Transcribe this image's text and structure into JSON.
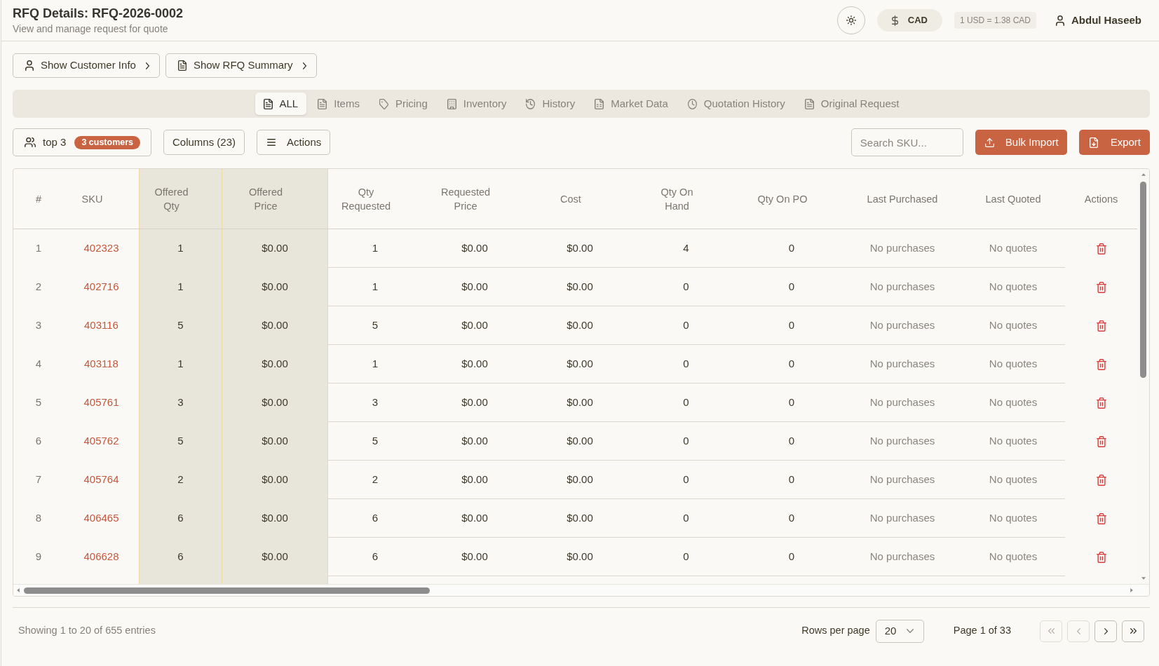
{
  "header": {
    "title": "RFQ Details: RFQ-2026-0002",
    "subtitle": "View and manage request for quote",
    "currency": "CAD",
    "exchange_rate": "1 USD = 1.38 CAD",
    "user": "Abdul Haseeb"
  },
  "panel_buttons": [
    {
      "label": "Show Customer Info"
    },
    {
      "label": "Show RFQ Summary"
    }
  ],
  "tabs": [
    {
      "label": "ALL",
      "selected": true
    },
    {
      "label": "Items",
      "selected": false
    },
    {
      "label": "Pricing",
      "selected": false
    },
    {
      "label": "Inventory",
      "selected": false
    },
    {
      "label": "History",
      "selected": false
    },
    {
      "label": "Market Data",
      "selected": false
    },
    {
      "label": "Quotation History",
      "selected": false
    },
    {
      "label": "Original Request",
      "selected": false
    }
  ],
  "toolbar": {
    "filter": {
      "label": "top 3",
      "badge": "3 customers"
    },
    "columns_button": "Columns (23)",
    "actions_button": "Actions",
    "search": {
      "placeholder": "Search SKU..."
    },
    "import_button": "Bulk Import",
    "export_button": "Export"
  },
  "table": {
    "columns": [
      {
        "label": "#",
        "highlighted": false
      },
      {
        "label": "SKU",
        "highlighted": false
      },
      {
        "label": "Offered Qty",
        "highlighted": true
      },
      {
        "label": "Offered Price",
        "highlighted": true
      },
      {
        "label": "Qty Requested",
        "highlighted": false
      },
      {
        "label": "Requested Price",
        "highlighted": false
      },
      {
        "label": "Cost",
        "highlighted": false
      },
      {
        "label": "Qty On Hand",
        "highlighted": false
      },
      {
        "label": "Qty On PO",
        "highlighted": false
      },
      {
        "label": "Last Purchased",
        "highlighted": false
      },
      {
        "label": "Last Quoted",
        "highlighted": false
      },
      {
        "label": "Actions",
        "highlighted": false
      }
    ],
    "rows": [
      {
        "cells": [
          "1",
          "402323",
          "1",
          "$0.00",
          "1",
          "$0.00",
          "$0.00",
          "4",
          "0",
          "No purchases",
          "No quotes"
        ]
      },
      {
        "cells": [
          "2",
          "402716",
          "1",
          "$0.00",
          "1",
          "$0.00",
          "$0.00",
          "0",
          "0",
          "No purchases",
          "No quotes"
        ]
      },
      {
        "cells": [
          "3",
          "403116",
          "5",
          "$0.00",
          "5",
          "$0.00",
          "$0.00",
          "0",
          "0",
          "No purchases",
          "No quotes"
        ]
      },
      {
        "cells": [
          "4",
          "403118",
          "1",
          "$0.00",
          "1",
          "$0.00",
          "$0.00",
          "0",
          "0",
          "No purchases",
          "No quotes"
        ]
      },
      {
        "cells": [
          "5",
          "405761",
          "3",
          "$0.00",
          "3",
          "$0.00",
          "$0.00",
          "0",
          "0",
          "No purchases",
          "No quotes"
        ]
      },
      {
        "cells": [
          "6",
          "405762",
          "5",
          "$0.00",
          "5",
          "$0.00",
          "$0.00",
          "0",
          "0",
          "No purchases",
          "No quotes"
        ]
      },
      {
        "cells": [
          "7",
          "405764",
          "2",
          "$0.00",
          "2",
          "$0.00",
          "$0.00",
          "0",
          "0",
          "No purchases",
          "No quotes"
        ]
      },
      {
        "cells": [
          "8",
          "406465",
          "6",
          "$0.00",
          "6",
          "$0.00",
          "$0.00",
          "0",
          "0",
          "No purchases",
          "No quotes"
        ]
      },
      {
        "cells": [
          "9",
          "406628",
          "6",
          "$0.00",
          "6",
          "$0.00",
          "$0.00",
          "0",
          "0",
          "No purchases",
          "No quotes"
        ]
      }
    ]
  },
  "footer": {
    "summary": "Showing 1 to 20 of 655 entries",
    "rows_per_page_label": "Rows per page",
    "rows_per_page": "20",
    "page_label": "Page 1 of 33",
    "page_buttons": [
      {
        "kind": "first",
        "disabled": true
      },
      {
        "kind": "previous",
        "disabled": true
      },
      {
        "kind": "next",
        "disabled": false
      },
      {
        "kind": "last",
        "disabled": false
      }
    ]
  }
}
